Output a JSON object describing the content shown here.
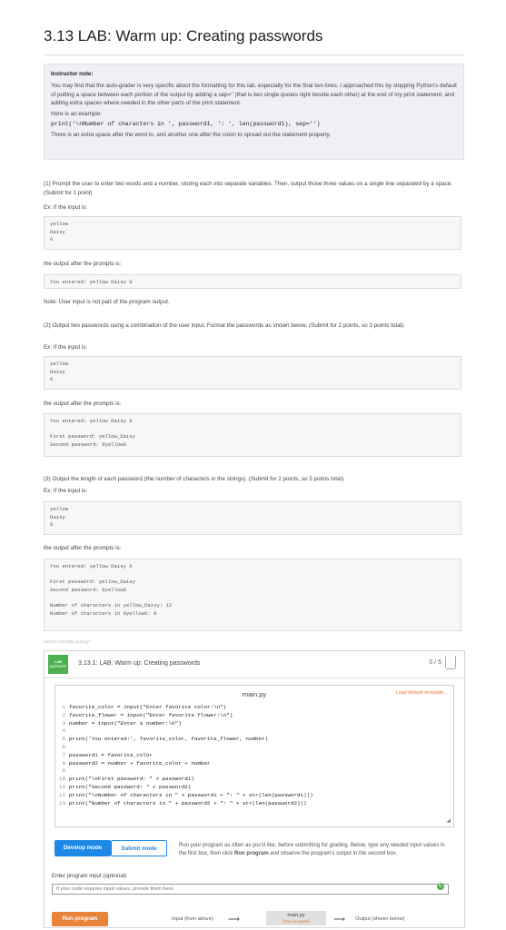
{
  "page": {
    "title": "3.13 LAB: Warm up: Creating passwords"
  },
  "note": {
    "heading": "Instructor note:",
    "p1": "You may find that the auto-grader is very specific about the formatting for this lab, especially for the final two lines. I approached this by stopping Python's default of putting a space between each portion of the output by adding a sep='' (that is two single quotes right beside each other) at the end of my print statement, and adding extra spaces where needed in the other parts of the print statement.",
    "p2": "Here is an example:",
    "code": "print('\\nNumber of characters in ', password1, ': ', len(password1), sep='')",
    "p3": "There is an extra space after the word in, and another one after the colon to spread out the statement properly."
  },
  "part1": {
    "text": "(1) Prompt the user to enter two words and a number, storing each into separate variables. Then, output those three values on a single line separated by a space. (Submit for 1 point)",
    "ex": "Ex: If the input is:",
    "input": "yellow\nDaisy\n6",
    "after": "the output after the prompts is:",
    "output": "You entered: yellow Daisy 6",
    "note": "Note: User input is not part of the program output."
  },
  "part2": {
    "text": "(2) Output two passwords using a combination of the user input. Format the passwords as shown below. (Submit for 2 points, so 3 points total).",
    "ex": "Ex: If the input is:",
    "input": "yellow\nDaisy\n6",
    "after": "the output after the prompts is:",
    "output": "You entered: yellow Daisy 6\n\nFirst password: yellow_Daisy\nSecond password: 6yellow6"
  },
  "part3": {
    "text": "(3) Output the length of each password (the number of characters in the strings). (Submit for 2 points, so 5 points total).",
    "ex": "Ex: If the input is:",
    "input": "yellow\nDaisy\n6",
    "after": "the output after the prompts is:",
    "output": "You entered: yellow Daisy 6\n\nFirst password: yellow_Daisy\nSecond password: 6yellow6\n\nNumber of characters in yellow_Daisy: 12\nNumber of characters in 6yellow6: 8"
  },
  "footer_id": "361532.2004096.qx3zqy7",
  "lab": {
    "badge_line1": "LAB",
    "badge_line2": "ACTIVITY",
    "title": "3.13.1: LAB: Warm up: Creating passwords",
    "score": "0 / 5",
    "filename": "main.py",
    "load_default": "Load default template...",
    "code_lines": [
      "favorite_color = input(\"Enter favorite color:\\n\")",
      "favorite_flower = input(\"Enter favorite flower:\\n\")",
      "number = input(\"Enter a number:\\n\")",
      "",
      "print('You entered:', favorite_color, favorite_flower, number)",
      "",
      "password1 = favorite_color",
      "password2 = number + favorite_color + number",
      "",
      "print(\"\\nFirst password: \" + password1)",
      "print(\"Second password: \" + password2)",
      "print(\"\\nNumber of characters in \" + password1 + \": \" + str(len(password1)))",
      "print(\"Number of characters in \" + password2 + \": \" + str(len(password2)))"
    ],
    "develop_mode": "Develop mode",
    "submit_mode": "Submit mode",
    "mode_text_1": "Run your program as often as you'd like, before submitting for grading. Below, type any needed input values in the first box, then click ",
    "mode_text_bold": "Run program",
    "mode_text_2": " and observe the program's output in the second box.",
    "input_label": "Enter program input (optional)",
    "input_placeholder": "If your code requires input values, provide them here.",
    "run_program": "Run program",
    "flow_input": "Input (from above)",
    "flow_main": "main.py",
    "flow_main_sub": "(Your program)",
    "flow_output": "Output (shown below)"
  }
}
